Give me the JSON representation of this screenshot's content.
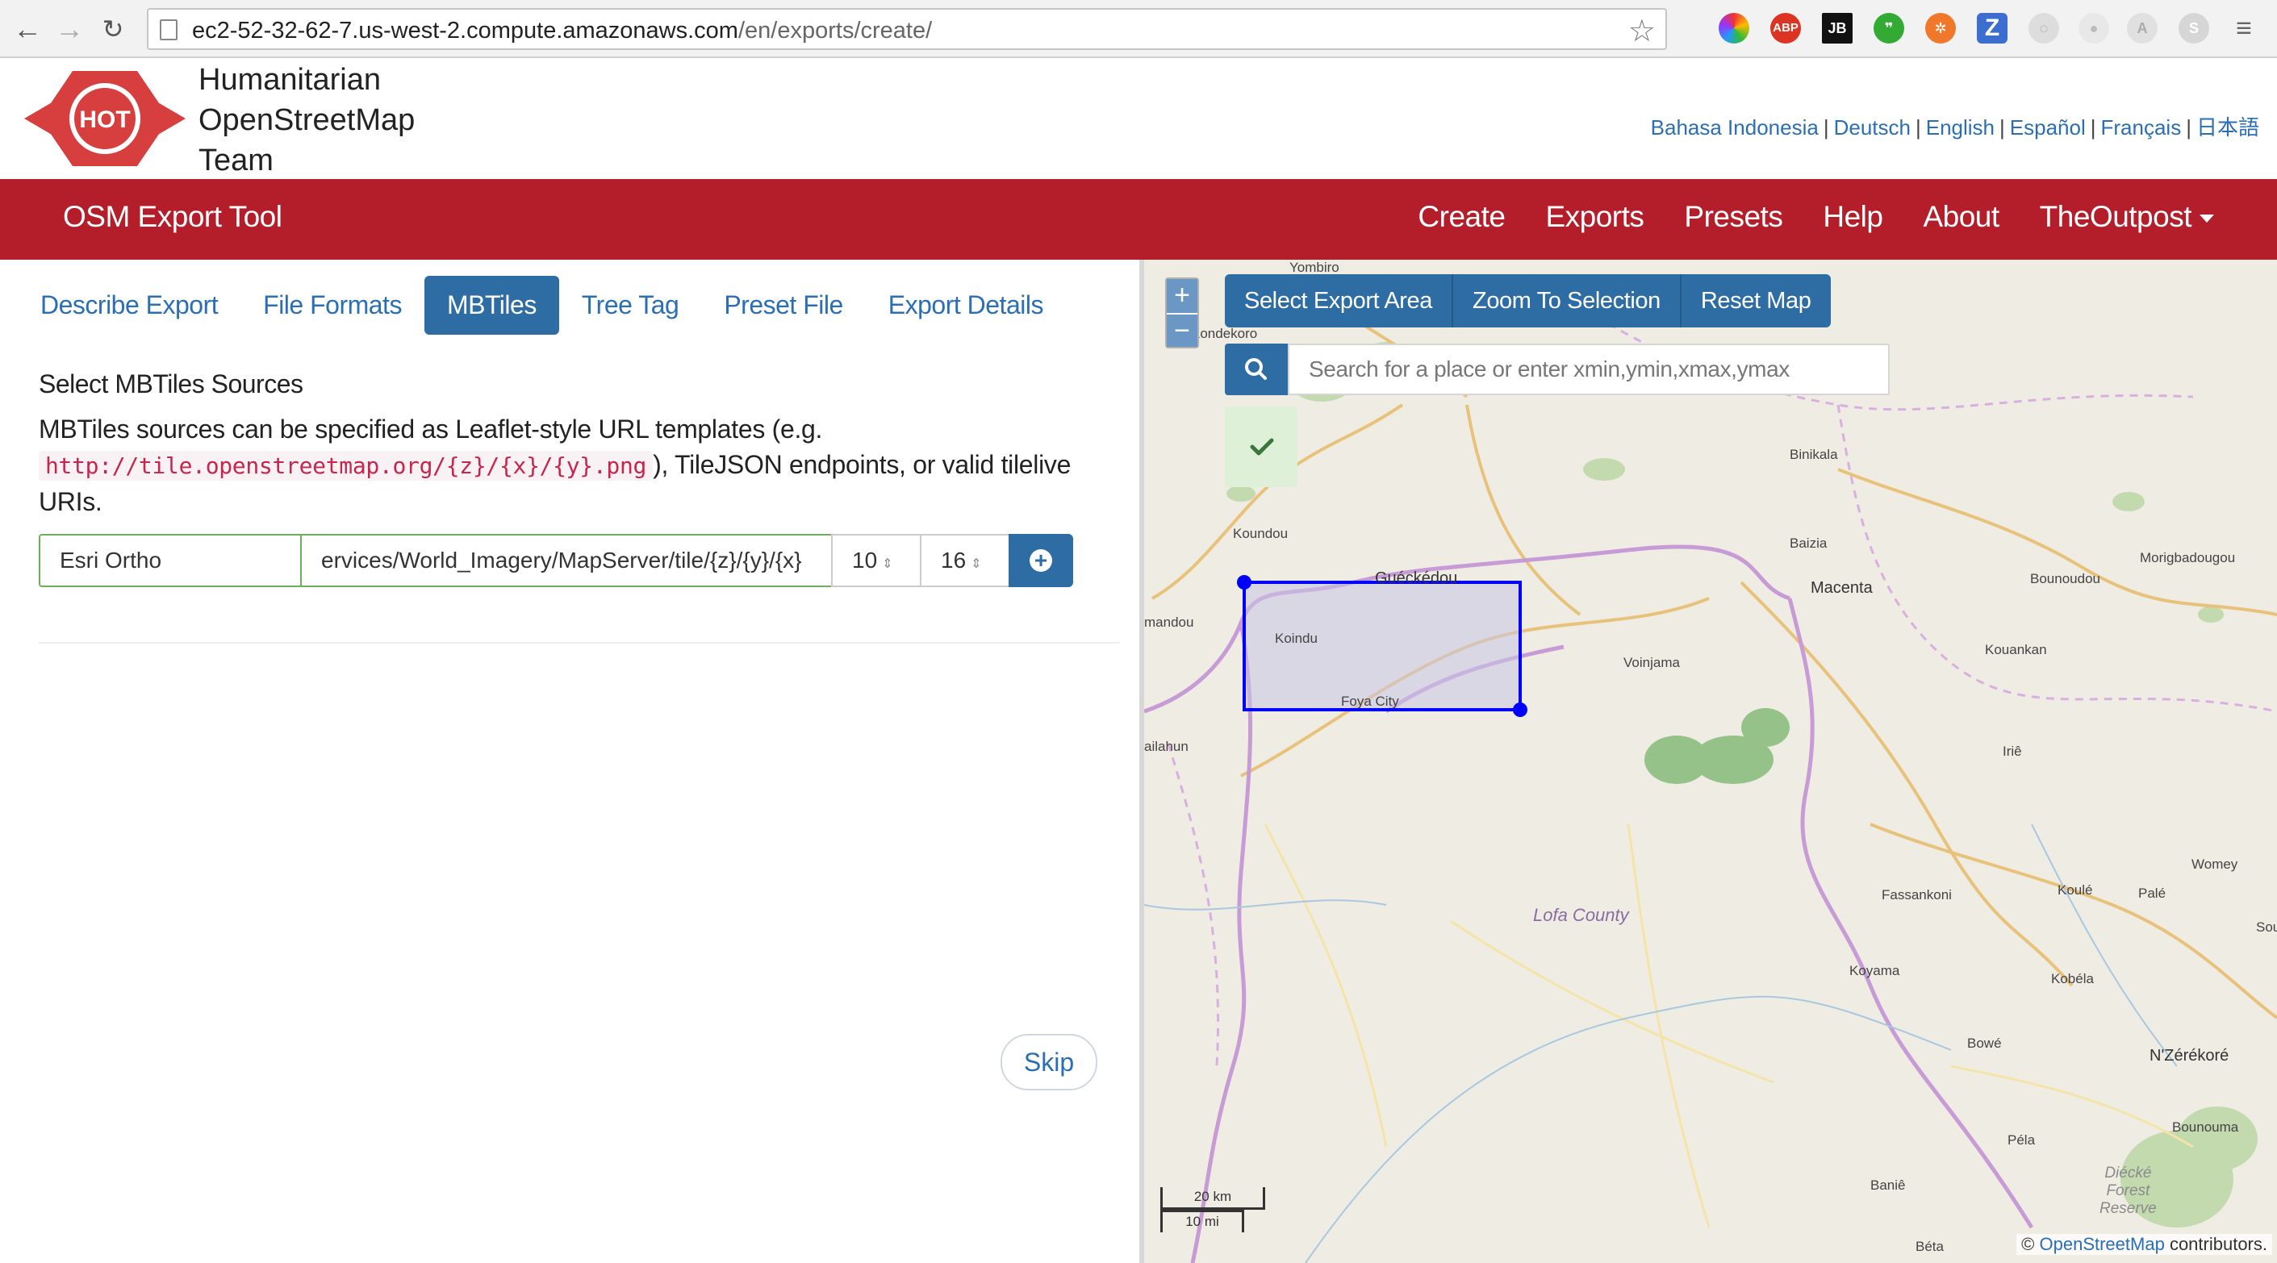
{
  "browser": {
    "url_host": "ec2-52-32-62-7.us-west-2.compute.amazonaws.com",
    "url_path": "/en/exports/create/",
    "extensions": [
      "color-wheel-icon",
      "adblock-plus-icon",
      "jb-icon",
      "evernote-icon",
      "extension-orange-icon",
      "zotero-icon",
      "loading-icon",
      "record-icon",
      "profile-icon",
      "skype-icon",
      "menu-icon"
    ],
    "ext_abp": "ABP",
    "ext_jb": "JB",
    "ext_z": "Z"
  },
  "header": {
    "logo_text": "HOT",
    "org_line1": "Humanitarian",
    "org_line2": "OpenStreetMap",
    "org_line3": "Team",
    "languages": [
      "Bahasa Indonesia",
      "Deutsch",
      "English",
      "Español",
      "Français",
      "日本語"
    ]
  },
  "nav": {
    "brand": "OSM Export Tool",
    "items": [
      "Create",
      "Exports",
      "Presets",
      "Help",
      "About",
      "TheOutpost"
    ]
  },
  "tabs": [
    "Describe Export",
    "File Formats",
    "MBTiles",
    "Tree Tag",
    "Preset File",
    "Export Details"
  ],
  "active_tab": "MBTiles",
  "mbtiles": {
    "title": "Select MBTiles Sources",
    "desc_before": "MBTiles sources can be specified as Leaflet-style URL templates (e.g.",
    "desc_code": "http://tile.openstreetmap.org/{z}/{x}/{y}.png",
    "desc_after": "), TileJSON endpoints, or valid tilelive URIs.",
    "source_name": "Esri Ortho",
    "source_url": "ervices/World_Imagery/MapServer/tile/{z}/{y}/{x}",
    "zoom_min": "10",
    "zoom_max": "16"
  },
  "skip_label": "Skip",
  "map": {
    "zoom_in": "+",
    "zoom_out": "−",
    "buttons": [
      "Select Export Area",
      "Zoom To Selection",
      "Reset Map"
    ],
    "search_placeholder": "Search for a place or enter xmin,ymin,xmax,ymax",
    "places": [
      "Yombiro",
      "Kondekoro",
      "Koundou",
      "Binikala",
      "Baizia",
      "Guéckédou",
      "Macenta",
      "Morigbadougou",
      "Bounoudou",
      "mandou",
      "Koindu",
      "Voinjama",
      "Foya City",
      "Kouankan",
      "ailahun",
      "Iriê",
      "Fassankoni",
      "Koulé",
      "Palé",
      "Womey",
      "Soulo",
      "Lofa County",
      "Koyama",
      "Kobéla",
      "Bowé",
      "N'Zérékoré",
      "Bounouma",
      "Péla",
      "Baniê",
      "Béta"
    ],
    "reserve_lines": [
      "Diécké",
      "Forest",
      "Reserve"
    ],
    "scale_km": "20 km",
    "scale_mi": "10 mi",
    "attribution_prefix": "©",
    "attribution_link": "OpenStreetMap",
    "attribution_suffix": "contributors.",
    "selection_color": "#0000ff",
    "selection_fill": "#c9c6e6"
  },
  "colors": {
    "nav_red": "#b31e2a",
    "primary_blue": "#2e6da4",
    "link_blue": "#2a6fb5",
    "success_green": "#def0d8"
  }
}
